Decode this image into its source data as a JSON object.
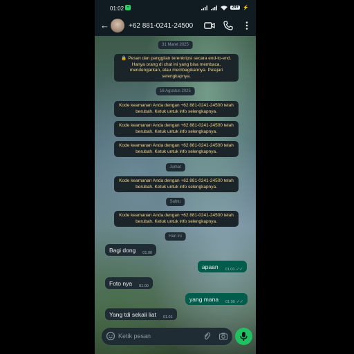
{
  "status_bar": {
    "time": "01:02",
    "battery": "24+"
  },
  "header": {
    "back_icon": "arrow-left-icon",
    "contact": "+62 881-0241-24500",
    "icons": [
      "video-icon",
      "phone-icon",
      "more-vert-icon"
    ]
  },
  "chat": {
    "date_1": "31 Maret 2025",
    "encryption_notice": "🔒 Pesan dan panggilan terenkripsi secara end-to-end. Hanya orang di chat ini yang bisa membaca, mendengarkan, atau membagikannya. Pelajari selengkapnya.",
    "date_2": "16 Agustus 2025",
    "security_notice": "Kode keamanan Anda dengan +62 881-0241-24500 telah berubah. Ketuk untuk info selengkapnya.",
    "date_3": "Jumat",
    "date_4": "Sabtu",
    "date_5": "Hari ini",
    "messages": [
      {
        "text": "Bagi dong",
        "time": "01.00",
        "dir": "in"
      },
      {
        "text": "apaan",
        "time": "01.00",
        "dir": "out"
      },
      {
        "text": "Foto nya",
        "time": "01.00",
        "dir": "in"
      },
      {
        "text": "yang mana",
        "time": "01.00",
        "dir": "out"
      },
      {
        "text": "Yang tdi sekali liat",
        "time": "01.01",
        "dir": "in"
      }
    ]
  },
  "input": {
    "placeholder": "Ketik pesan"
  },
  "colors": {
    "incoming": "#202c33",
    "outgoing": "#005c4b",
    "accent": "#21c063",
    "system_text": "#f0d28a"
  }
}
